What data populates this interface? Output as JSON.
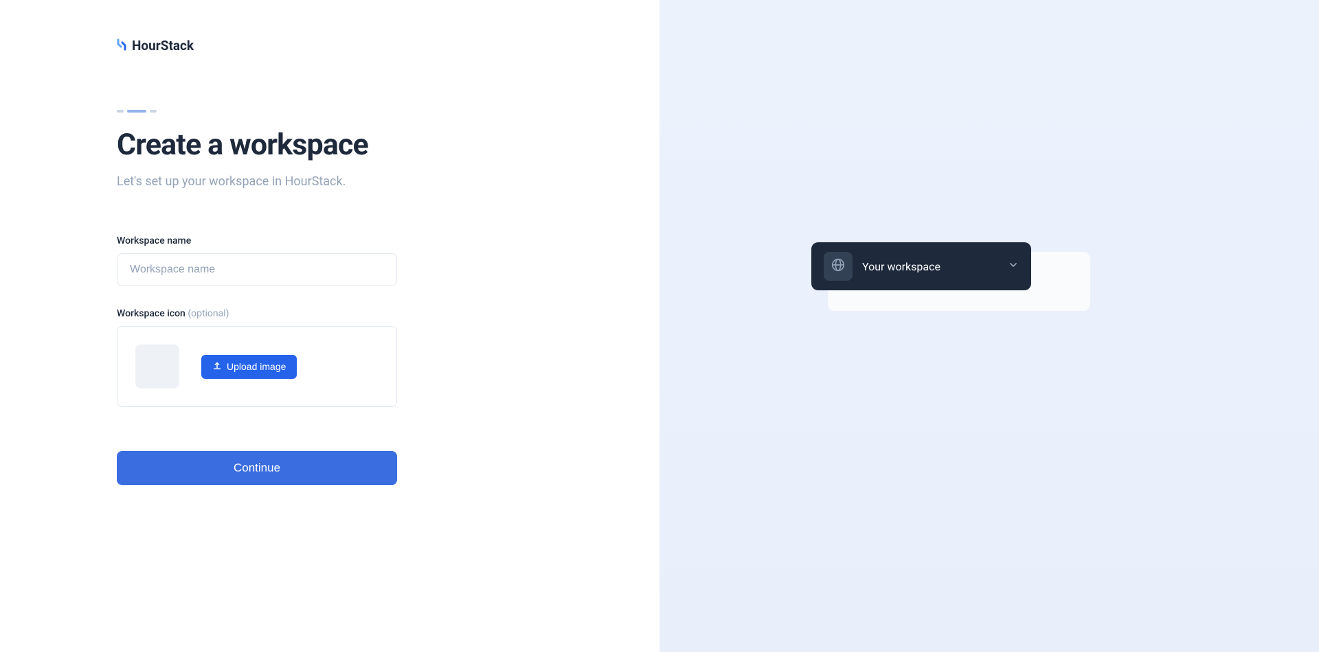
{
  "logo": {
    "text": "HourStack"
  },
  "page": {
    "heading": "Create a workspace",
    "subheading": "Let's set up your workspace in HourStack."
  },
  "form": {
    "workspace_name": {
      "label": "Workspace name",
      "placeholder": "Workspace name",
      "value": ""
    },
    "workspace_icon": {
      "label": "Workspace icon",
      "optional_text": "(optional)",
      "upload_label": "Upload image"
    },
    "continue_label": "Continue"
  },
  "preview": {
    "workspace_selector_label": "Your workspace"
  }
}
